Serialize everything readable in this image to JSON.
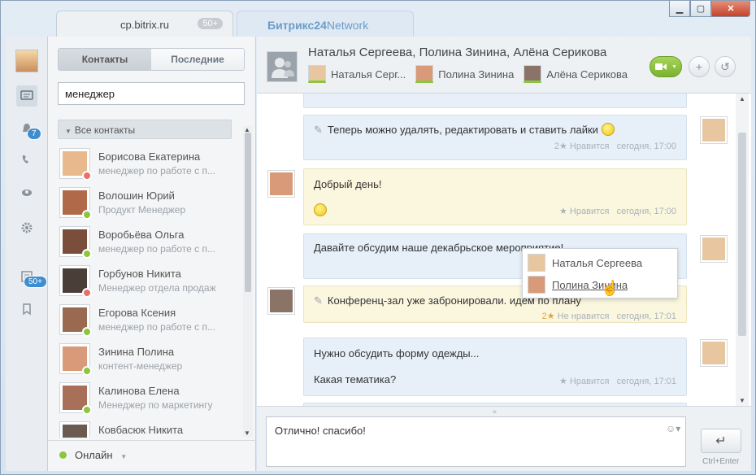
{
  "tabs": {
    "active_label": "cp.bitrix.ru",
    "active_badge": "50+",
    "network_label_bold": "Битрикс24",
    "network_label_rest": "Network"
  },
  "rail": {
    "notifications_badge": "7",
    "feed_badge": "50+"
  },
  "contacts_panel": {
    "tab_contacts": "Контакты",
    "tab_recent": "Последние",
    "search_value": "менеджер",
    "group_label": "Все контакты",
    "items": [
      {
        "name": "Борисова Екатерина",
        "position": "менеджер по работе с п...",
        "status_color": "#e9706a",
        "face": "#e8b98c"
      },
      {
        "name": "Волошин Юрий",
        "position": "Продукт Менеджер",
        "status_color": "#8cc63f",
        "face": "#b06a4a"
      },
      {
        "name": "Воробьёва Ольга",
        "position": "менеджер по работе с п...",
        "status_color": "#8cc63f",
        "face": "#7a4e3a"
      },
      {
        "name": "Горбунов Никита",
        "position": "Менеджер отдела продаж",
        "status_color": "#e9706a",
        "face": "#4a3e38"
      },
      {
        "name": "Егорова Ксения",
        "position": "менеджер по работе с п...",
        "status_color": "#8cc63f",
        "face": "#9a6a50"
      },
      {
        "name": "Зинина Полина",
        "position": "контент-менеджер",
        "status_color": "#8cc63f",
        "face": "#d89a78"
      },
      {
        "name": "Калинова Елена",
        "position": "Менеджер по маркетингу",
        "status_color": "#8cc63f",
        "face": "#a87058"
      },
      {
        "name": "Ковбасюк Никита",
        "position": "",
        "status_color": "#8cc63f",
        "face": "#6a5a50"
      }
    ],
    "status_label": "Онлайн"
  },
  "chat": {
    "title": "Наталья Сергеева, Полина Зинина, Алёна Серикова",
    "participants": [
      {
        "name": "Наталья Серг..."
      },
      {
        "name": "Полина Зинина"
      },
      {
        "name": "Алёна Серикова"
      }
    ],
    "messages": {
      "m1_text": "Теперь можно удалять, редактировать и ставить лайки",
      "m1_likes": "2",
      "m1_like_label": "Нравится",
      "m1_time": "сегодня, 17:00",
      "m2_text": "Добрый день!",
      "m2_like_label": "Нравится",
      "m2_time": "сегодня, 17:00",
      "m3_text": "Давайте обсудим наше декабрьское мероприятие!",
      "m4_text": "Конференц-зал уже забронировали. идем по плану",
      "m4_likes": "2",
      "m4_like_label": "Не нравится",
      "m4_time": "сегодня, 17:01",
      "m5_line1": "Нужно обсудить форму одежды...",
      "m5_line2": "Какая тематика?",
      "m5_like_label": "Нравится",
      "m5_time": "сегодня, 17:01"
    },
    "likes_popup": [
      {
        "name": "Наталья Сергеева"
      },
      {
        "name": "Полина Зинина"
      }
    ],
    "input_value": "Отлично! спасибо!",
    "send_hint": "Ctrl+Enter"
  },
  "colors": {
    "accent_green": "#8cc63f",
    "accent_blue": "#3e8ecf",
    "blue_bubble": "#e7f0f8",
    "yellow_bubble": "#fbf7df"
  }
}
